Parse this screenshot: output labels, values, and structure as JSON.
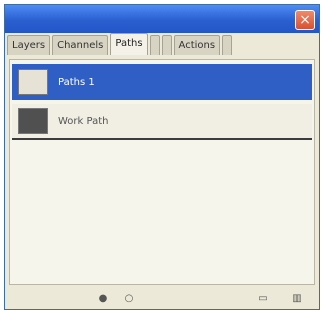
{
  "window": {
    "close_glyph": "×"
  },
  "tabs": [
    {
      "label": "Layers",
      "active": false
    },
    {
      "label": "Channels",
      "active": false
    },
    {
      "label": "Paths",
      "active": true
    },
    {
      "label": "",
      "active": false
    },
    {
      "label": "",
      "active": false
    },
    {
      "label": "Actions",
      "active": false
    },
    {
      "label": "",
      "active": false
    }
  ],
  "layers": [
    {
      "name": "Paths 1",
      "selected": true
    },
    {
      "name": "Work Path",
      "selected": false
    }
  ],
  "bottom_icons": [
    "fill-path-icon",
    "stroke-path-icon",
    "new-path-icon",
    "delete-path-icon"
  ],
  "colors": {
    "accent": "#2f5fc4",
    "title_gradient": "#2a5fd0",
    "close": "#d9502e"
  }
}
